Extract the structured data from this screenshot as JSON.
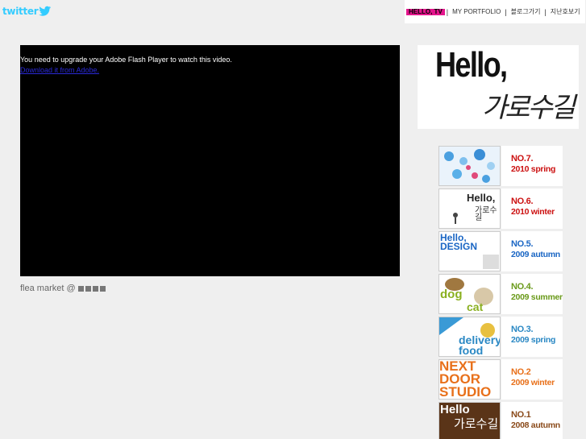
{
  "header": {
    "twitter_logo": "twitter",
    "nav": [
      {
        "label": "HELLO, TV",
        "active": true
      },
      {
        "label": "MY PORTFOLIO",
        "active": false
      },
      {
        "label": "블로그가기",
        "active": false
      },
      {
        "label": "지난호보기",
        "active": false
      }
    ],
    "separator": "|"
  },
  "video": {
    "message": "You need to upgrade your Adobe Flash Player to watch this video.",
    "download_link": "Download it from Adobe."
  },
  "caption": {
    "text": "flea market @"
  },
  "banner": {
    "hello": "Hello,",
    "korean": "가로수길"
  },
  "issues": [
    {
      "number": "NO.7.",
      "season": "2010 spring",
      "color": "#cc1111",
      "thumb_icon": "snow-illustration"
    },
    {
      "number": "NO.6.",
      "season": "2010 winter",
      "color": "#cc1111",
      "thumb_icon": "hello-handwriting",
      "thumb_hello": "Hello,",
      "thumb_korean": "가로수길"
    },
    {
      "number": "NO.5.",
      "season": "2009 autumn",
      "color": "#1a66c4",
      "thumb_icon": "hello-design",
      "thumb_line1": "Hello,",
      "thumb_line2": "DESIGN"
    },
    {
      "number": "NO.4.",
      "season": "2009 summer",
      "color": "#6a9a1a",
      "thumb_icon": "dog-cat",
      "thumb_line1": "dog",
      "thumb_line2": "cat"
    },
    {
      "number": "NO.3.",
      "season": "2009 spring",
      "color": "#2a88c4",
      "thumb_icon": "delivery-food",
      "thumb_line1": "delivery",
      "thumb_line2": "food"
    },
    {
      "number": "NO.2",
      "season": "2009 winter",
      "color": "#e8701a",
      "thumb_icon": "next-door-studio",
      "thumb_line1": "NEXT",
      "thumb_line2": "DOOR",
      "thumb_line3": "STUDIO"
    },
    {
      "number": "NO.1",
      "season": "2008 autumn",
      "color": "#8a4a1a",
      "thumb_icon": "hello-brown",
      "thumb_hello": "Hello",
      "thumb_korean": "가로수길"
    }
  ]
}
